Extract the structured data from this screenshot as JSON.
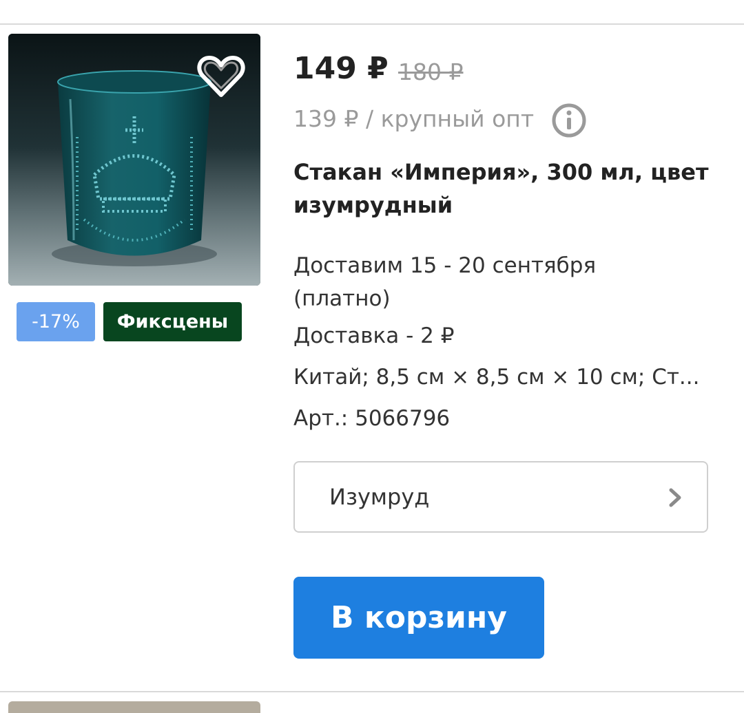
{
  "product": {
    "price": "149 ₽",
    "old_price": "180 ₽",
    "wholesale_price": "139 ₽ / крупный опт",
    "title": "Стакан «Империя», 300 мл, цвет изумрудный",
    "delivery_date": "Доставим 15 - 20 сентября (платно)",
    "delivery_cost": "Доставка - 2 ₽",
    "specs": "Китай; 8,5 см × 8,5 см × 10 см; Ст...",
    "sku": "Арт.: 5066796",
    "image_icon": "emerald-glass-photo"
  },
  "badges": {
    "discount": "-17%",
    "fixprice": "Фиксцены"
  },
  "variant": {
    "selected": "Изумруд"
  },
  "actions": {
    "cart_label": "В корзину"
  },
  "icons": {
    "favorite": "heart-outline-icon",
    "info": "info-circle-icon",
    "chevron": "chevron-right-icon"
  },
  "colors": {
    "accent": "#1e7fe0",
    "discount_badge": "#6aa2ee",
    "fixprice_badge": "#08461f",
    "muted_text": "#9a9a9a"
  }
}
